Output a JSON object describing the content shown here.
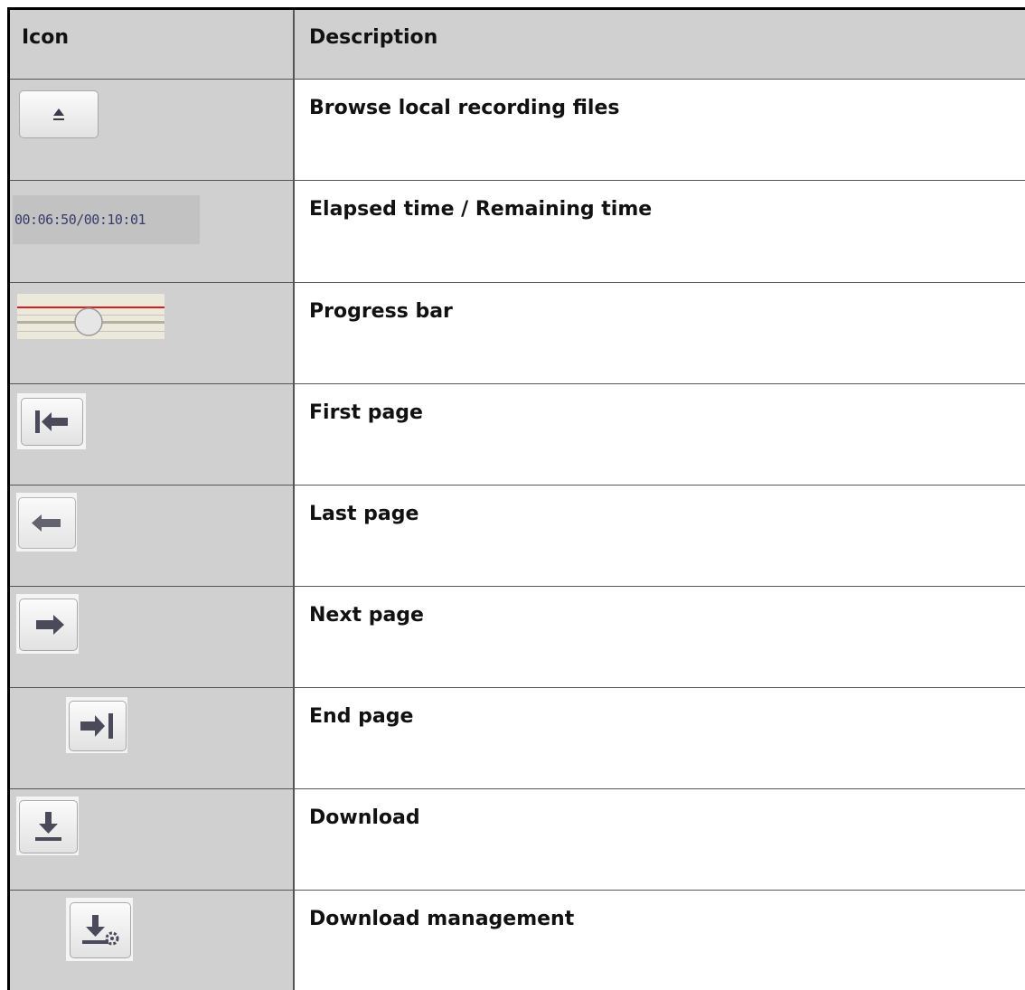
{
  "table": {
    "headers": {
      "icon": "Icon",
      "description": "Description"
    },
    "rows": [
      {
        "icon": "eject-icon",
        "description": "Browse local recording files"
      },
      {
        "icon": "time-display",
        "time_text": "00:06:50/00:10:01",
        "description": "Elapsed time / Remaining time"
      },
      {
        "icon": "progress-slider-icon",
        "description": "Progress bar"
      },
      {
        "icon": "first-page-icon",
        "description": "First page"
      },
      {
        "icon": "previous-page-icon",
        "description": "Last page"
      },
      {
        "icon": "next-page-icon",
        "description": "Next page"
      },
      {
        "icon": "end-page-icon",
        "description": "End page"
      },
      {
        "icon": "download-icon",
        "description": "Download"
      },
      {
        "icon": "download-management-icon",
        "description": "Download management"
      }
    ]
  },
  "colors": {
    "cell_gray": "#d0d0d0",
    "icon_arrow": "#4a4a5a",
    "progress_red": "#d02020"
  }
}
